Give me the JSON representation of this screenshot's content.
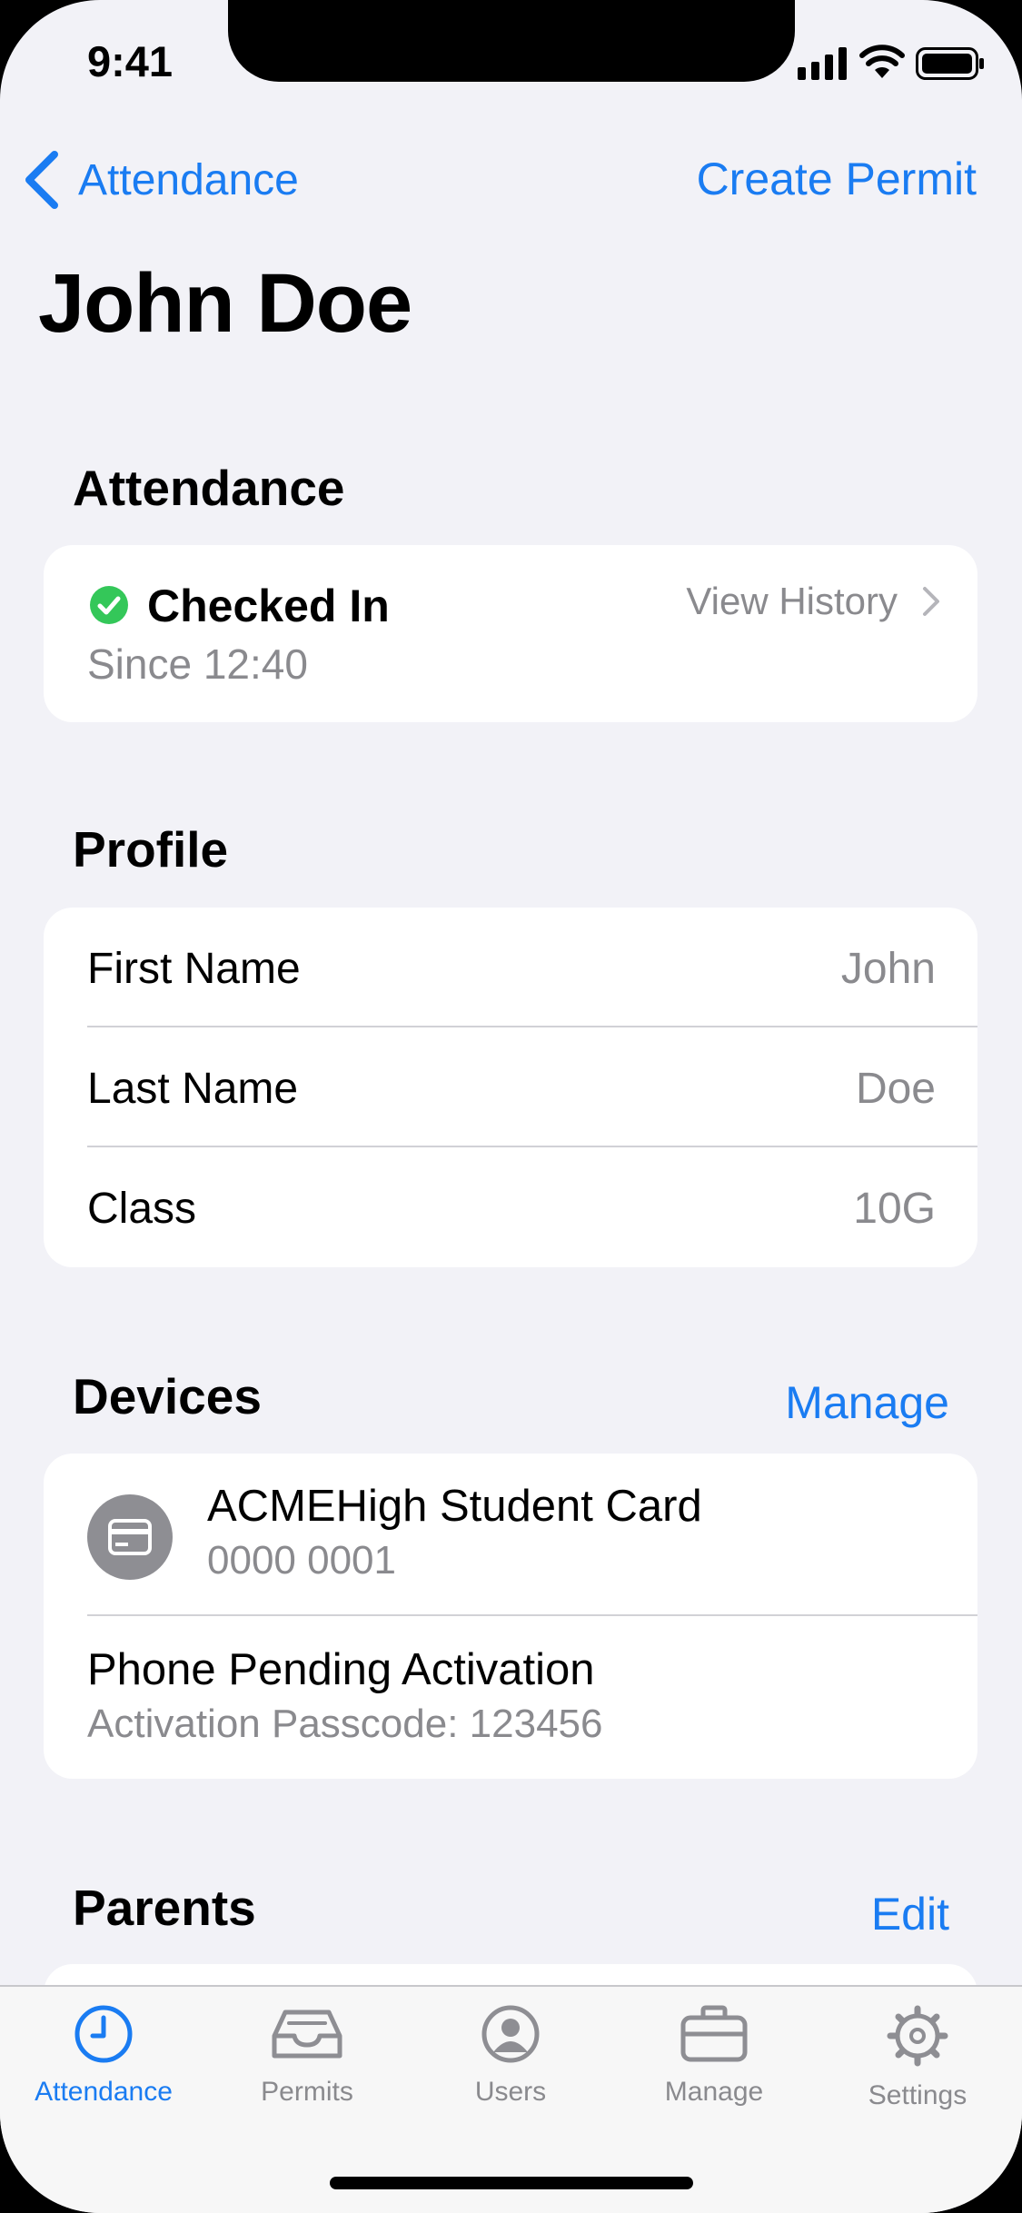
{
  "status_bar": {
    "time": "9:41"
  },
  "nav": {
    "back_label": "Attendance",
    "action_label": "Create Permit",
    "title": "John Doe"
  },
  "attendance": {
    "section_title": "Attendance",
    "status": "Checked In",
    "since": "Since 12:40",
    "view_history": "View History"
  },
  "profile": {
    "section_title": "Profile",
    "rows": [
      {
        "label": "First Name",
        "value": "John"
      },
      {
        "label": "Last Name",
        "value": "Doe"
      },
      {
        "label": "Class",
        "value": "10G"
      }
    ]
  },
  "devices": {
    "section_title": "Devices",
    "action_label": "Manage",
    "items": [
      {
        "title": "ACMEHigh Student Card",
        "subtitle": "0000 0001",
        "icon": "card-icon"
      },
      {
        "title": "Phone Pending Activation",
        "subtitle": "Activation Passcode: 123456"
      }
    ]
  },
  "parents": {
    "section_title": "Parents",
    "action_label": "Edit"
  },
  "tab_bar": {
    "tabs": [
      {
        "label": "Attendance",
        "icon": "clock-icon",
        "active": true
      },
      {
        "label": "Permits",
        "icon": "tray-icon",
        "active": false
      },
      {
        "label": "Users",
        "icon": "person-circle-icon",
        "active": false
      },
      {
        "label": "Manage",
        "icon": "briefcase-icon",
        "active": false
      },
      {
        "label": "Settings",
        "icon": "gear-icon",
        "active": false
      }
    ]
  },
  "colors": {
    "accent": "#1a7cf2",
    "success": "#34c759",
    "background": "#f2f2f7"
  }
}
